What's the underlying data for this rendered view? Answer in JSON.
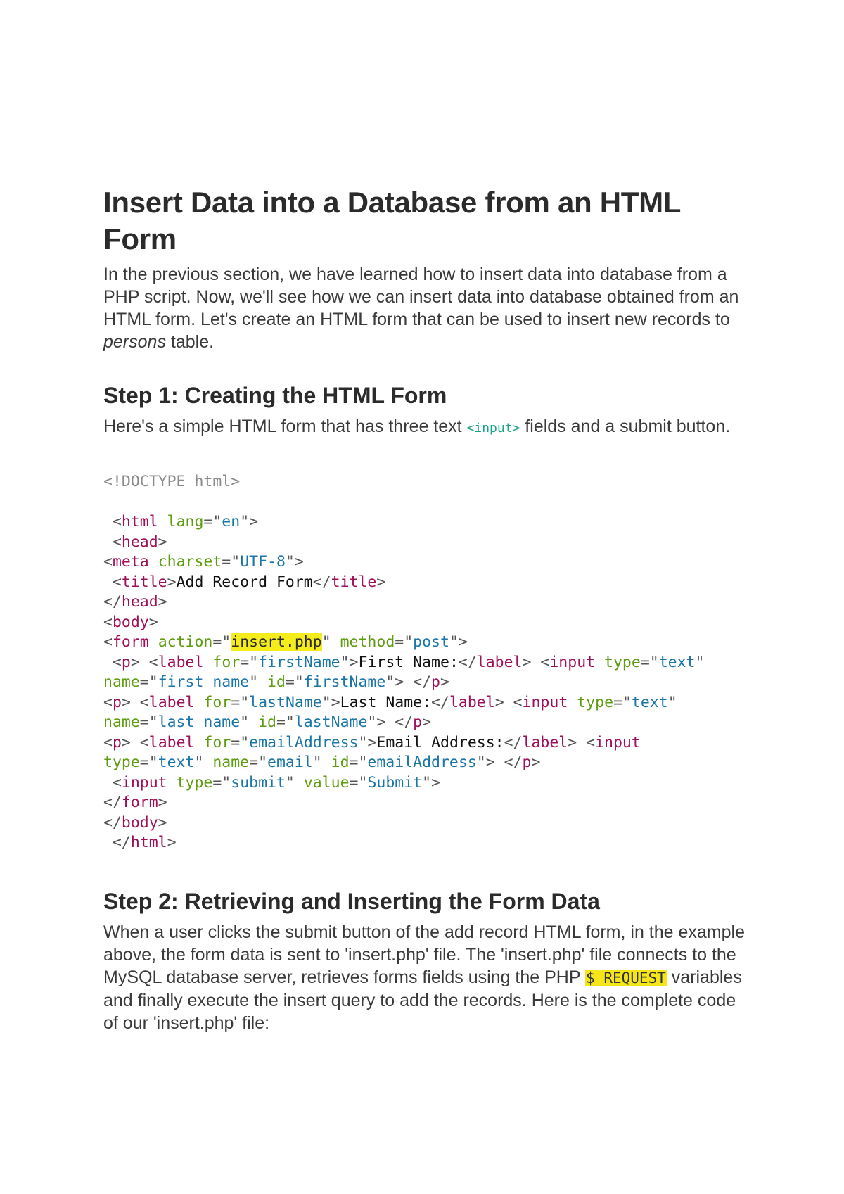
{
  "article": {
    "title": "Insert Data into a Database from an HTML Form",
    "intro": {
      "before_em": "In the previous section, we have learned how to insert data into database from a PHP script. Now, we'll see how we can insert data into database obtained from an HTML form. Let's create an HTML form that can be used to insert new records to ",
      "em": "persons",
      "after_em": " table."
    },
    "step1": {
      "heading": "Step 1: Creating the HTML Form",
      "text_before": "Here's a simple HTML form that has three text ",
      "inline_code": "<input>",
      "text_after": " fields and a submit button."
    },
    "code": {
      "lines": [
        [
          {
            "t": "doc",
            "v": "<!DOCTYPE html>"
          }
        ],
        [],
        [
          {
            "t": "pun",
            "v": " <"
          },
          {
            "t": "tag",
            "v": "html"
          },
          {
            "t": "pun",
            "v": " "
          },
          {
            "t": "attr",
            "v": "lang"
          },
          {
            "t": "pun",
            "v": "=\""
          },
          {
            "t": "str",
            "v": "en"
          },
          {
            "t": "pun",
            "v": "\">"
          }
        ],
        [
          {
            "t": "pun",
            "v": " <"
          },
          {
            "t": "tag",
            "v": "head"
          },
          {
            "t": "pun",
            "v": ">"
          }
        ],
        [
          {
            "t": "pun",
            "v": "<"
          },
          {
            "t": "tag",
            "v": "meta"
          },
          {
            "t": "pun",
            "v": " "
          },
          {
            "t": "attr",
            "v": "charset"
          },
          {
            "t": "pun",
            "v": "=\""
          },
          {
            "t": "str",
            "v": "UTF-8"
          },
          {
            "t": "pun",
            "v": "\">"
          }
        ],
        [
          {
            "t": "pun",
            "v": " <"
          },
          {
            "t": "tag",
            "v": "title"
          },
          {
            "t": "pun",
            "v": ">"
          },
          {
            "t": "txt",
            "v": "Add Record Form"
          },
          {
            "t": "pun",
            "v": "</"
          },
          {
            "t": "tag",
            "v": "title"
          },
          {
            "t": "pun",
            "v": ">"
          }
        ],
        [
          {
            "t": "pun",
            "v": "</"
          },
          {
            "t": "tag",
            "v": "head"
          },
          {
            "t": "pun",
            "v": ">"
          }
        ],
        [
          {
            "t": "pun",
            "v": "<"
          },
          {
            "t": "tag",
            "v": "body"
          },
          {
            "t": "pun",
            "v": ">"
          }
        ],
        [
          {
            "t": "pun",
            "v": "<"
          },
          {
            "t": "tag",
            "v": "form"
          },
          {
            "t": "pun",
            "v": " "
          },
          {
            "t": "attr",
            "v": "action"
          },
          {
            "t": "pun",
            "v": "=\""
          },
          {
            "t": "hl",
            "v": "insert.php"
          },
          {
            "t": "pun",
            "v": "\" "
          },
          {
            "t": "attr",
            "v": "method"
          },
          {
            "t": "pun",
            "v": "=\""
          },
          {
            "t": "str",
            "v": "post"
          },
          {
            "t": "pun",
            "v": "\">"
          }
        ],
        [
          {
            "t": "pun",
            "v": " <"
          },
          {
            "t": "tag",
            "v": "p"
          },
          {
            "t": "pun",
            "v": "> <"
          },
          {
            "t": "tag",
            "v": "label"
          },
          {
            "t": "pun",
            "v": " "
          },
          {
            "t": "attr",
            "v": "for"
          },
          {
            "t": "pun",
            "v": "=\""
          },
          {
            "t": "str",
            "v": "firstName"
          },
          {
            "t": "pun",
            "v": "\">"
          },
          {
            "t": "txt",
            "v": "First Name:"
          },
          {
            "t": "pun",
            "v": "</"
          },
          {
            "t": "tag",
            "v": "label"
          },
          {
            "t": "pun",
            "v": "> <"
          },
          {
            "t": "tag",
            "v": "input"
          },
          {
            "t": "pun",
            "v": " "
          },
          {
            "t": "attr",
            "v": "type"
          },
          {
            "t": "pun",
            "v": "=\""
          },
          {
            "t": "str",
            "v": "text"
          },
          {
            "t": "pun",
            "v": "\""
          }
        ],
        [
          {
            "t": "attr",
            "v": "name"
          },
          {
            "t": "pun",
            "v": "=\""
          },
          {
            "t": "str",
            "v": "first_name"
          },
          {
            "t": "pun",
            "v": "\" "
          },
          {
            "t": "attr",
            "v": "id"
          },
          {
            "t": "pun",
            "v": "=\""
          },
          {
            "t": "str",
            "v": "firstName"
          },
          {
            "t": "pun",
            "v": "\"> </"
          },
          {
            "t": "tag",
            "v": "p"
          },
          {
            "t": "pun",
            "v": ">"
          }
        ],
        [
          {
            "t": "pun",
            "v": "<"
          },
          {
            "t": "tag",
            "v": "p"
          },
          {
            "t": "pun",
            "v": "> <"
          },
          {
            "t": "tag",
            "v": "label"
          },
          {
            "t": "pun",
            "v": " "
          },
          {
            "t": "attr",
            "v": "for"
          },
          {
            "t": "pun",
            "v": "=\""
          },
          {
            "t": "str",
            "v": "lastName"
          },
          {
            "t": "pun",
            "v": "\">"
          },
          {
            "t": "txt",
            "v": "Last Name:"
          },
          {
            "t": "pun",
            "v": "</"
          },
          {
            "t": "tag",
            "v": "label"
          },
          {
            "t": "pun",
            "v": "> <"
          },
          {
            "t": "tag",
            "v": "input"
          },
          {
            "t": "pun",
            "v": " "
          },
          {
            "t": "attr",
            "v": "type"
          },
          {
            "t": "pun",
            "v": "=\""
          },
          {
            "t": "str",
            "v": "text"
          },
          {
            "t": "pun",
            "v": "\""
          }
        ],
        [
          {
            "t": "attr",
            "v": "name"
          },
          {
            "t": "pun",
            "v": "=\""
          },
          {
            "t": "str",
            "v": "last_name"
          },
          {
            "t": "pun",
            "v": "\" "
          },
          {
            "t": "attr",
            "v": "id"
          },
          {
            "t": "pun",
            "v": "=\""
          },
          {
            "t": "str",
            "v": "lastName"
          },
          {
            "t": "pun",
            "v": "\"> </"
          },
          {
            "t": "tag",
            "v": "p"
          },
          {
            "t": "pun",
            "v": ">"
          }
        ],
        [
          {
            "t": "pun",
            "v": "<"
          },
          {
            "t": "tag",
            "v": "p"
          },
          {
            "t": "pun",
            "v": "> <"
          },
          {
            "t": "tag",
            "v": "label"
          },
          {
            "t": "pun",
            "v": " "
          },
          {
            "t": "attr",
            "v": "for"
          },
          {
            "t": "pun",
            "v": "=\""
          },
          {
            "t": "str",
            "v": "emailAddress"
          },
          {
            "t": "pun",
            "v": "\">"
          },
          {
            "t": "txt",
            "v": "Email Address:"
          },
          {
            "t": "pun",
            "v": "</"
          },
          {
            "t": "tag",
            "v": "label"
          },
          {
            "t": "pun",
            "v": "> <"
          },
          {
            "t": "tag",
            "v": "input"
          }
        ],
        [
          {
            "t": "attr",
            "v": "type"
          },
          {
            "t": "pun",
            "v": "=\""
          },
          {
            "t": "str",
            "v": "text"
          },
          {
            "t": "pun",
            "v": "\" "
          },
          {
            "t": "attr",
            "v": "name"
          },
          {
            "t": "pun",
            "v": "=\""
          },
          {
            "t": "str",
            "v": "email"
          },
          {
            "t": "pun",
            "v": "\" "
          },
          {
            "t": "attr",
            "v": "id"
          },
          {
            "t": "pun",
            "v": "=\""
          },
          {
            "t": "str",
            "v": "emailAddress"
          },
          {
            "t": "pun",
            "v": "\"> </"
          },
          {
            "t": "tag",
            "v": "p"
          },
          {
            "t": "pun",
            "v": ">"
          }
        ],
        [
          {
            "t": "pun",
            "v": " <"
          },
          {
            "t": "tag",
            "v": "input"
          },
          {
            "t": "pun",
            "v": " "
          },
          {
            "t": "attr",
            "v": "type"
          },
          {
            "t": "pun",
            "v": "=\""
          },
          {
            "t": "str",
            "v": "submit"
          },
          {
            "t": "pun",
            "v": "\" "
          },
          {
            "t": "attr",
            "v": "value"
          },
          {
            "t": "pun",
            "v": "=\""
          },
          {
            "t": "str",
            "v": "Submit"
          },
          {
            "t": "pun",
            "v": "\">"
          }
        ],
        [
          {
            "t": "pun",
            "v": "</"
          },
          {
            "t": "tag",
            "v": "form"
          },
          {
            "t": "pun",
            "v": ">"
          }
        ],
        [
          {
            "t": "pun",
            "v": "</"
          },
          {
            "t": "tag",
            "v": "body"
          },
          {
            "t": "pun",
            "v": ">"
          }
        ],
        [
          {
            "t": "pun",
            "v": " </"
          },
          {
            "t": "tag",
            "v": "html"
          },
          {
            "t": "pun",
            "v": ">"
          }
        ]
      ]
    },
    "step2": {
      "heading": "Step 2: Retrieving and Inserting the Form Data",
      "text_before": "When a user clicks the submit button of the add record HTML form, in the example above, the form data is sent to 'insert.php' file. The 'insert.php' file connects to the MySQL database server, retrieves forms fields using the PHP ",
      "highlight_code": "$_REQUEST",
      "text_after": " variables and finally execute the insert query to add the records. Here is the complete code of our 'insert.php' file:"
    }
  },
  "colors": {
    "tag": "#a0105a",
    "attribute": "#5e9c10",
    "string": "#1b76a8",
    "doctype": "#8a8a8a",
    "highlight": "#f5e61a",
    "inline_code": "#1aa58a"
  }
}
